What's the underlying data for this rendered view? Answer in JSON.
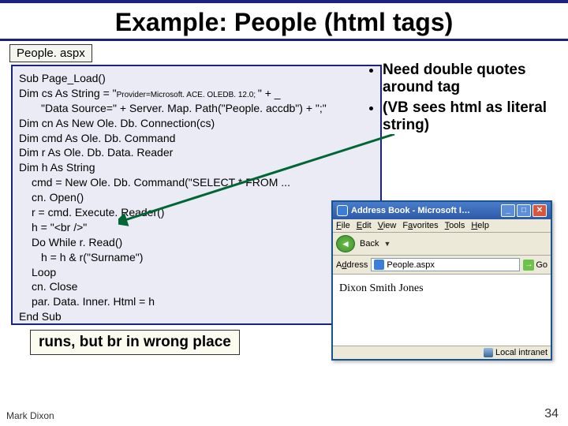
{
  "title": "Example: People (html tags)",
  "filename": "People. aspx",
  "code": {
    "l1": "Sub Page_Load()",
    "l2a": "Dim cs As String = \"",
    "l2b": "Provider=Microsoft. ACE. OLEDB. 12.0; ",
    "l2c": "\" + _",
    "l3": "\"Data Source=\" + Server. Map. Path(\"People. accdb\") + \";\"",
    "l4": "Dim cn   As New Ole. Db. Connection(cs)",
    "l5": "Dim cmd  As Ole. Db. Command",
    "l6": "Dim r    As Ole. Db. Data. Reader",
    "l7": "Dim h    As String",
    "l8": "cmd = New Ole. Db. Command(\"SELECT * FROM ...",
    "l9": "cn. Open()",
    "l10": "r = cmd. Execute. Reader()",
    "l11": "h = \"<br />\"",
    "l12": "Do While r. Read()",
    "l13": "h = h & r(\"Surname\")",
    "l14": "Loop",
    "l15": "cn. Close",
    "l16": "par. Data. Inner. Html = h",
    "l17": "End Sub"
  },
  "bullets": {
    "b1": "Need double quotes around tag",
    "b2": "(VB sees html as literal string)"
  },
  "caption": "runs, but br in wrong place",
  "browser": {
    "title": "Address Book - Microsoft I…",
    "menu": {
      "file": "File",
      "edit": "Edit",
      "view": "View",
      "fav": "Favorites",
      "tools": "Tools",
      "help": "Help"
    },
    "back": "Back",
    "addr_label": "Address",
    "addr_value": "People.aspx",
    "go": "Go",
    "content": "Dixon Smith Jones",
    "status": "Local intranet"
  },
  "footer": {
    "author": "Mark Dixon",
    "page": "34"
  }
}
